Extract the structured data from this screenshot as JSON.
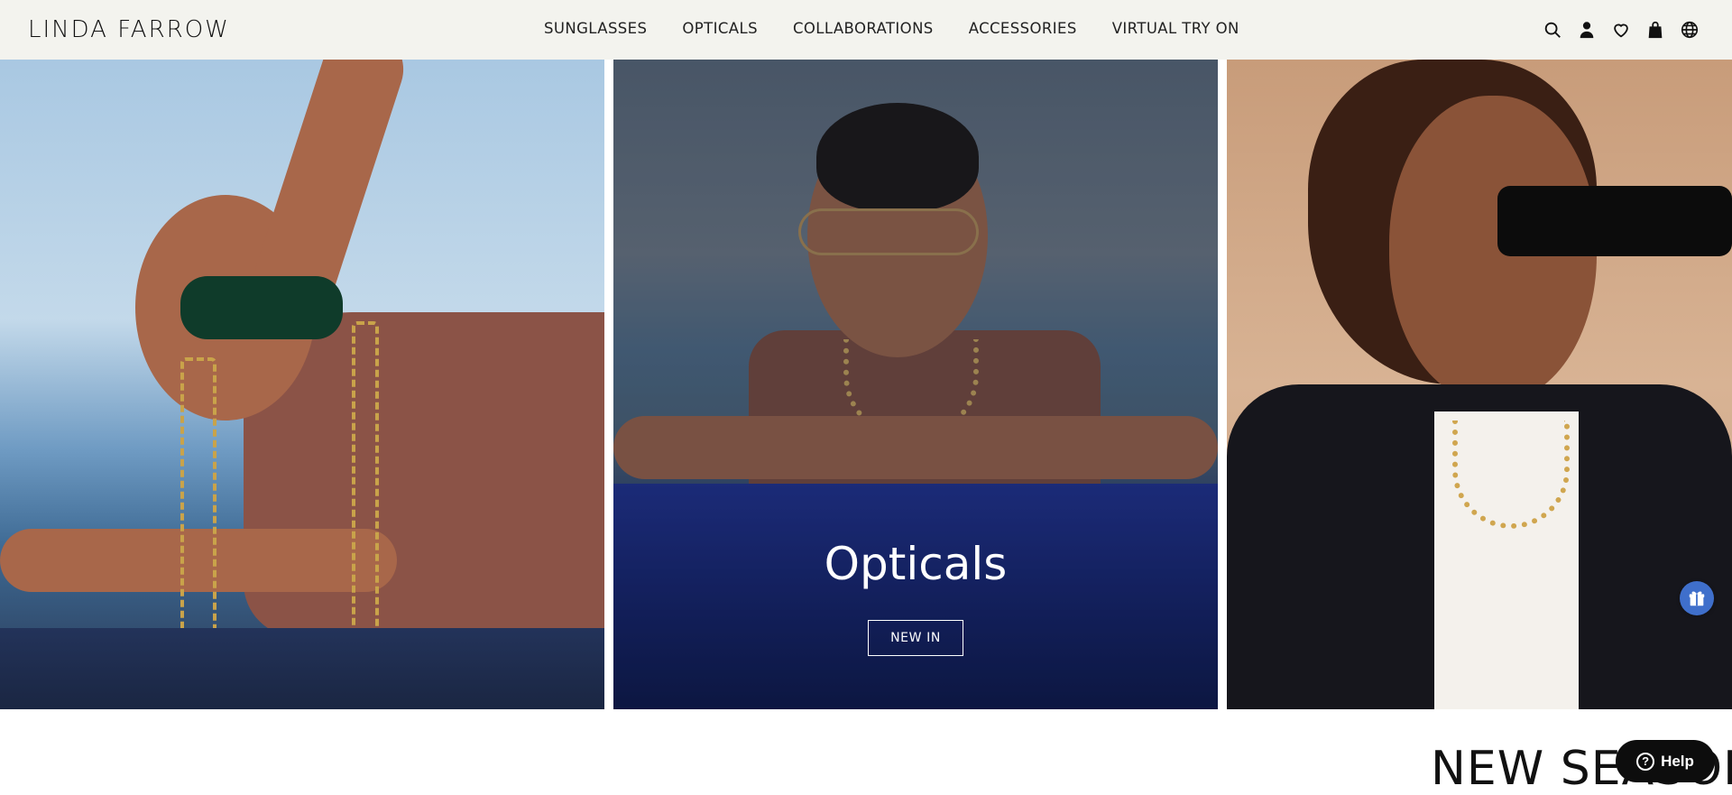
{
  "header": {
    "logo": "LINDA FARROW",
    "nav": [
      {
        "label": "SUNGLASSES"
      },
      {
        "label": "OPTICALS"
      },
      {
        "label": "COLLABORATIONS"
      },
      {
        "label": "ACCESSORIES"
      },
      {
        "label": "VIRTUAL TRY ON"
      }
    ],
    "icons": [
      "search-icon",
      "account-icon",
      "wishlist-heart-icon",
      "shopping-bag-icon",
      "globe-icon"
    ]
  },
  "hero": {
    "panels": [
      {
        "name": "sunglasses-panel",
        "title": "",
        "button": ""
      },
      {
        "name": "opticals-panel",
        "title": "Opticals",
        "button": "NEW IN"
      },
      {
        "name": "collaborations-panel",
        "title": "",
        "button": ""
      }
    ]
  },
  "section": {
    "title": "NEW SEASON"
  },
  "widgets": {
    "gift_icon": "gift-icon",
    "help_label": "Help",
    "help_icon": "question-icon"
  },
  "colors": {
    "header_bg": "#f3f3ee",
    "gift_bg": "#3f6fcb",
    "help_bg": "#0d0d0d"
  }
}
